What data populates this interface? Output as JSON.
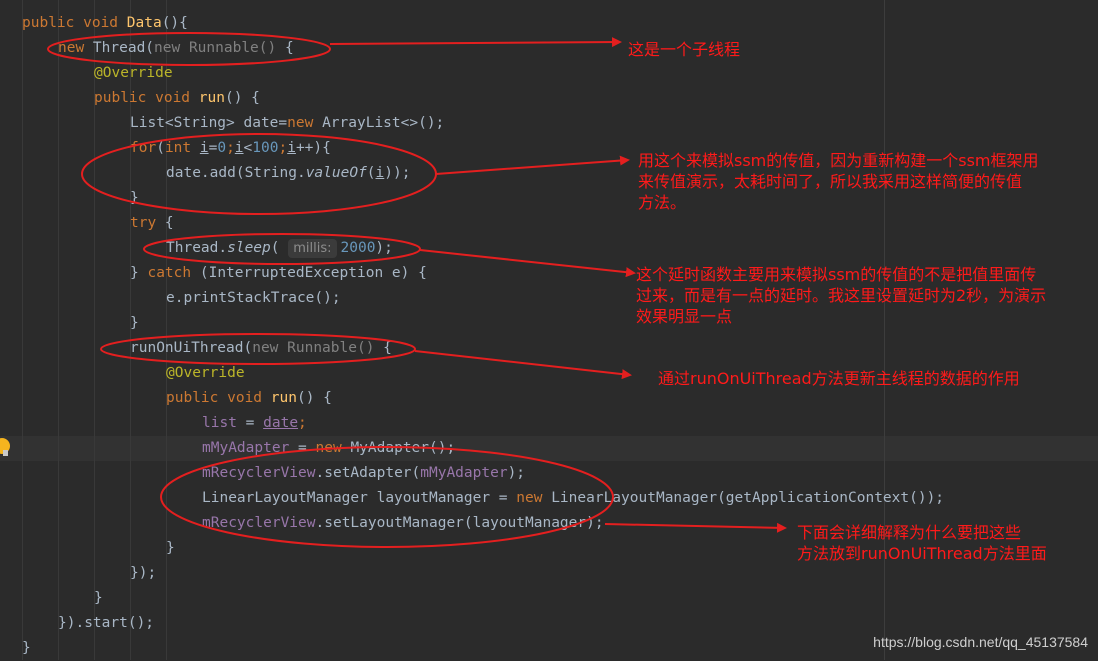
{
  "code": {
    "l1": {
      "t1": "public void ",
      "t2": "Data",
      "t3": "(){"
    },
    "l2": {
      "t1": "new ",
      "t2": "Thread(",
      "t3": "new Runnable() ",
      "t4": "{"
    },
    "l3": {
      "t1": "@Override"
    },
    "l4": {
      "t1": "public void ",
      "t2": "run",
      "t3": "() {"
    },
    "l5": {
      "t1": "List<String> date=",
      "t2": "new ",
      "t3": "ArrayList<>();"
    },
    "l6": {
      "t1": "for",
      "t2": "(",
      "t3": "int ",
      "t4": "i",
      "t5": "=",
      "t6": "0",
      "t7": ";",
      "t8": "i",
      "t9": "<",
      "t10": "100",
      "t11": ";",
      "t12": "i",
      "t13": "++){"
    },
    "l7": {
      "t1": "date.add(String.",
      "t2": "valueOf",
      "t3": "(",
      "t4": "i",
      "t5": "));"
    },
    "l8": {
      "t1": "}"
    },
    "l9": {
      "t1": "try ",
      "t2": "{"
    },
    "l10": {
      "t1": "Thread.",
      "t2": "sleep",
      "t3": "( ",
      "t4": "millis:",
      "t5": "2000",
      "t6": ");"
    },
    "l11": {
      "t1": "} ",
      "t2": "catch ",
      "t3": "(InterruptedException e) {"
    },
    "l12": {
      "t1": "e.printStackTrace();"
    },
    "l13": {
      "t1": "}"
    },
    "l14": {
      "t1": "runOnUiThread(",
      "t2": "new Runnable() ",
      "t3": "{"
    },
    "l15": {
      "t1": "@Override"
    },
    "l16": {
      "t1": "public void ",
      "t2": "run",
      "t3": "() {"
    },
    "l17": {
      "t1": "list",
      "t2": " = ",
      "t3": "date",
      "t4": ";"
    },
    "l18": {
      "t1": "mMyAdapter",
      "t2": " = ",
      "t3": "new ",
      "t4": "MyAdapter();"
    },
    "l19": {
      "t1": "mRecyclerView",
      "t2": ".setAdapter(",
      "t3": "mMyAdapter",
      "t4": ");"
    },
    "l20": {
      "t1": "LinearLayoutManager layoutManager = ",
      "t2": "new ",
      "t3": "LinearLayoutManager(getApplicationContext());"
    },
    "l21": {
      "t1": "mRecyclerView",
      "t2": ".setLayoutManager(layoutManager);"
    },
    "l22": {
      "t1": "}"
    },
    "l23": {
      "t1": "});"
    },
    "l24": {
      "t1": "}"
    },
    "l25": {
      "t1": "}).start();"
    },
    "l26": {
      "t1": "}"
    }
  },
  "annotations": {
    "note1": "这是一个子线程",
    "note2_line1": "用这个来模拟ssm的传值，因为重新构建一个ssm框架用",
    "note2_line2": "来传值演示，太耗时间了，所以我采用这样简便的传值",
    "note2_line3": "方法。",
    "note3_line1": "这个延时函数主要用来模拟ssm的传值的不是把值里面传",
    "note3_line2": "过来，而是有一点的延时。我这里设置延时为2秒，为演示",
    "note3_line3": "效果明显一点",
    "note4": "通过runOnUiThread方法更新主线程的数据的作用",
    "note5_line1": "下面会详细解释为什么要把这些",
    "note5_line2": "方法放到runOnUiThread方法里面"
  },
  "watermark": "https://blog.csdn.net/qq_45137584",
  "colors": {
    "annotation": "#ff1a1a",
    "background": "#2b2b2b",
    "keyword": "#cc7832",
    "method": "#ffc66d",
    "number": "#6897bb",
    "field": "#9876aa"
  },
  "icons": {
    "gutter": "lightbulb-icon"
  }
}
